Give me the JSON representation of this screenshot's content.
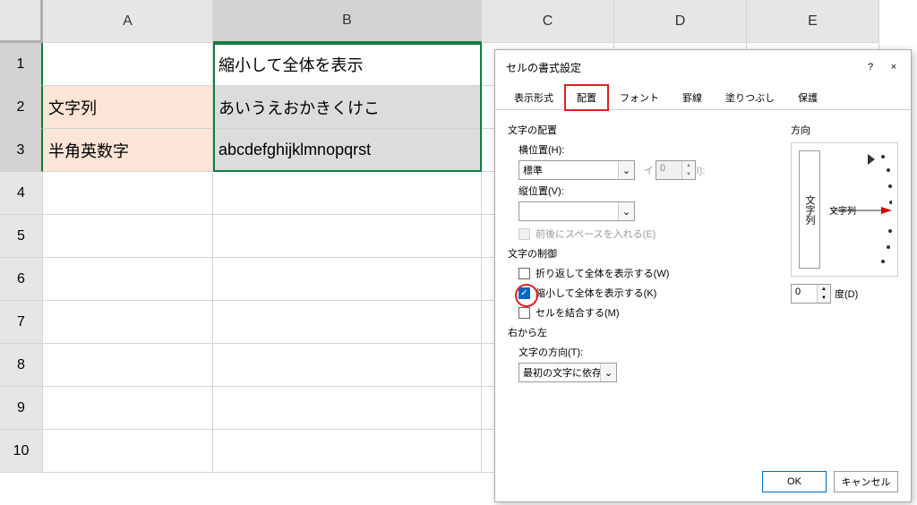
{
  "columns": [
    "A",
    "B",
    "C",
    "D",
    "E"
  ],
  "rows": [
    "1",
    "2",
    "3",
    "4",
    "5",
    "6",
    "7",
    "8",
    "9",
    "10"
  ],
  "cells": {
    "b1": "縮小して全体を表示",
    "a2": "文字列",
    "b2": "あいうえおかきくけこ",
    "a3": "半角英数字",
    "b3": "abcdefghijklmnopqrst"
  },
  "dialog": {
    "title": "セルの書式設定",
    "help_char": "?",
    "close_char": "×",
    "tabs": {
      "t1": "表示形式",
      "t2": "配置",
      "t3": "フォント",
      "t4": "罫線",
      "t5": "塗りつぶし",
      "t6": "保護"
    },
    "section_align": "文字の配置",
    "horiz_label": "横位置(H):",
    "horiz_value": "標準",
    "indent_label": "インデント(I):",
    "indent_value": "0",
    "vert_label": "縦位置(V):",
    "vert_value": "",
    "justify_label": "前後にスペースを入れる(E)",
    "section_ctrl": "文字の制御",
    "wrap_label": "折り返して全体を表示する(W)",
    "shrink_label": "縮小して全体を表示する(K)",
    "merge_label": "セルを結合する(M)",
    "section_rtl": "右から左",
    "dir_label": "文字の方向(T):",
    "dir_value": "最初の文字に依存",
    "section_orient": "方向",
    "orient_vert_text": "文字列",
    "orient_horiz_text": "文字列",
    "degree_value": "0",
    "degree_label": "度(D)",
    "btn_ok": "OK",
    "btn_cancel": "キャンセル"
  }
}
